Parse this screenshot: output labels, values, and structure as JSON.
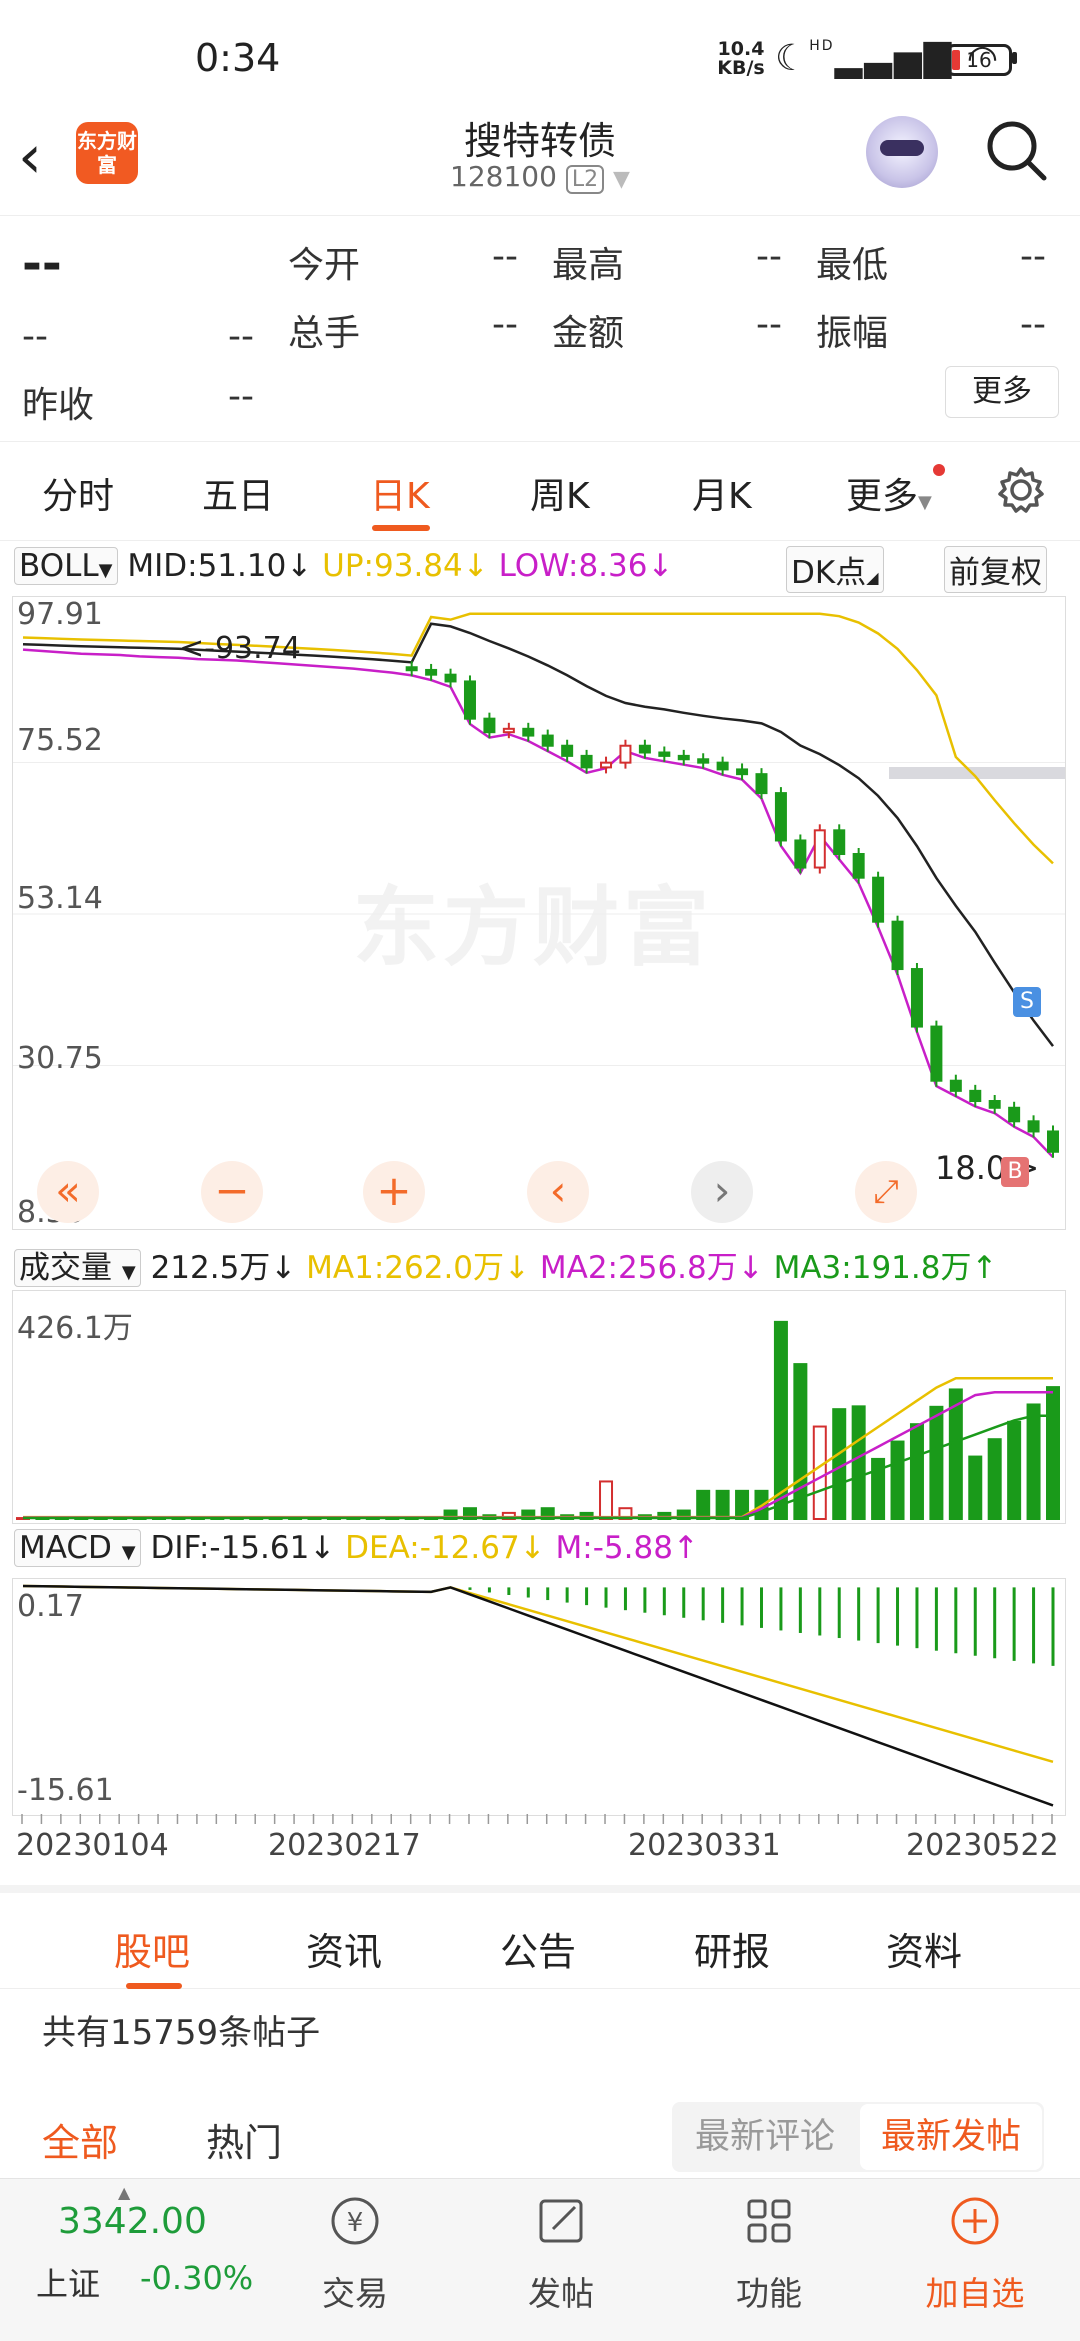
{
  "status_bar": {
    "time": "0:34",
    "net_speed": "10.4",
    "net_unit": "KB/s",
    "signal": "HD",
    "battery": "16"
  },
  "header": {
    "title": "搜特转债",
    "code": "128100",
    "level": "L2",
    "logo_text": "东方财富"
  },
  "quote": {
    "price": "--",
    "change": "--",
    "change_pct": "--",
    "yesterday_close_label": "昨收",
    "yesterday_close": "--",
    "fields": [
      {
        "label": "今开",
        "value": "--"
      },
      {
        "label": "最高",
        "value": "--"
      },
      {
        "label": "最低",
        "value": "--"
      },
      {
        "label": "总手",
        "value": "--"
      },
      {
        "label": "金额",
        "value": "--"
      },
      {
        "label": "振幅",
        "value": "--"
      }
    ],
    "more": "更多"
  },
  "period_tabs": [
    "分时",
    "五日",
    "日K",
    "周K",
    "月K",
    "更多"
  ],
  "active_period": "日K",
  "boll": {
    "name": "BOLL",
    "mid": "MID:51.10",
    "up": "UP:93.84",
    "low": "LOW:8.36",
    "dk": "DK点",
    "adjust": "前复权"
  },
  "kline": {
    "y_labels": [
      "97.91",
      "75.52",
      "53.14",
      "30.75",
      "8.36"
    ],
    "max_label": "<-93.74",
    "last_label": "18.0",
    "buy_mark": "B",
    "sell_mark": "S",
    "watermark": "东方财富"
  },
  "volume": {
    "name": "成交量",
    "value": "212.5万",
    "ma1": "MA1:262.0万",
    "ma2": "MA2:256.8万",
    "ma3": "MA3:191.8万",
    "max": "426.1万"
  },
  "macd": {
    "name": "MACD",
    "dif": "DIF:-15.61",
    "dea": "DEA:-12.67",
    "m": "M:-5.88",
    "top": "0.17",
    "bottom": "-15.61"
  },
  "dates": [
    "20230104",
    "20230217",
    "20230331",
    "20230522"
  ],
  "colors": {
    "accent": "#ef5a1f",
    "up": "#d32f2f",
    "down": "#1a9a1a",
    "mid": "#222222",
    "upper": "#e8c000",
    "lower": "#c81fc8"
  },
  "chart_data": {
    "type": "candlestick",
    "title": "",
    "ylim": [
      8.36,
      97.91
    ],
    "x_range": [
      "20230104",
      "20230522"
    ],
    "boll": {
      "mid": 51.1,
      "up": 93.84,
      "low": 8.36
    },
    "close_series": [
      93.0,
      92.8,
      92.6,
      92.4,
      92.3,
      92.2,
      92.0,
      91.9,
      91.8,
      91.6,
      91.5,
      91.4,
      91.2,
      91.0,
      90.8,
      90.6,
      90.4,
      90.2,
      89.9,
      89.6,
      89.2,
      88.5,
      87.5,
      82.0,
      80.0,
      80.5,
      79.5,
      78.0,
      76.5,
      74.8,
      75.5,
      78.0,
      77.0,
      76.5,
      76.0,
      75.5,
      74.5,
      73.8,
      71.0,
      64.0,
      60.0,
      65.5,
      62.0,
      58.5,
      52.0,
      45.0,
      36.5,
      28.5,
      27.0,
      25.5,
      24.5,
      22.5,
      21.0,
      18.0
    ],
    "volume_max": 426.1,
    "volume_unit": "万",
    "macd": {
      "dif": -15.61,
      "dea": -12.67,
      "m": -5.88,
      "range": [
        -15.61,
        0.17
      ]
    }
  },
  "info_tabs": [
    "股吧",
    "资讯",
    "公告",
    "研报",
    "资料"
  ],
  "posts_count": "共有15759条帖子",
  "filters": {
    "all": "全部",
    "hot": "热门",
    "latest_comment": "最新评论",
    "latest_post": "最新发帖"
  },
  "bottom_bar": {
    "index_value": "3342.00",
    "index_name": "上证",
    "index_change": "-0.30%",
    "items": [
      "交易",
      "发帖",
      "功能",
      "加自选"
    ]
  }
}
